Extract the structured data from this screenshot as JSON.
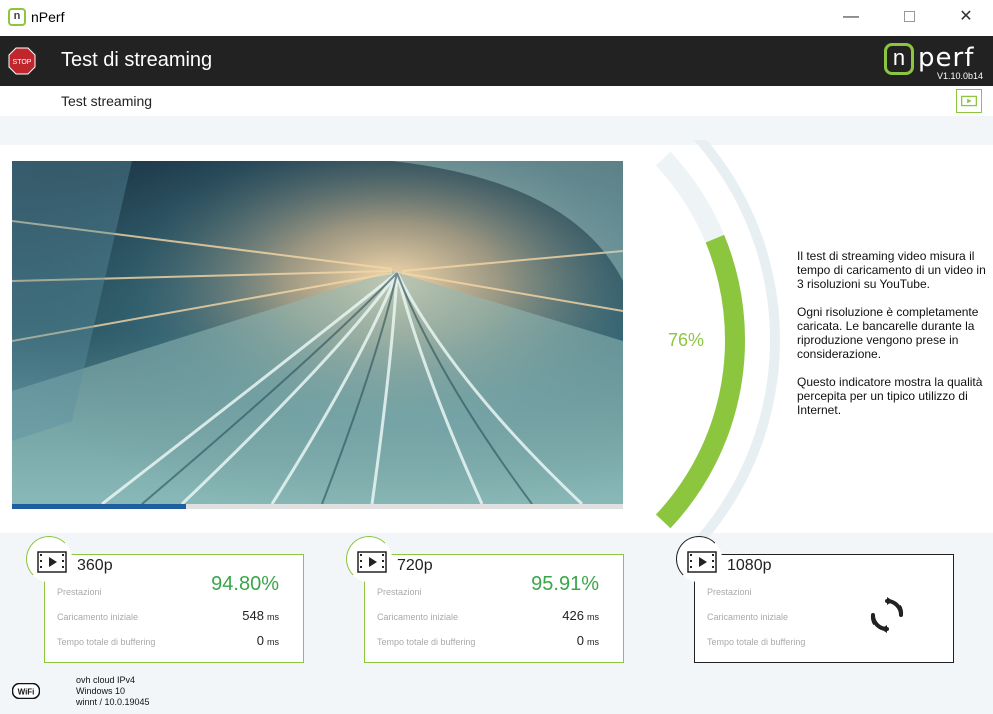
{
  "window": {
    "title": "nPerf",
    "icon_letter": "n",
    "minimize_glyph": "—",
    "close_glyph": "✕"
  },
  "header": {
    "title": "Test di streaming",
    "stop_label": "STOP",
    "logo_n": "n",
    "logo_text": "perf",
    "version": "V1.10.0b14"
  },
  "subheader": {
    "title": "Test streaming"
  },
  "video": {
    "progress_fraction": 0.285
  },
  "gauge": {
    "percent_label": "76%",
    "value": 0.76
  },
  "description": [
    "Il test di streaming video misura il tempo di caricamento di un video in 3 risoluzioni su YouTube.",
    "Ogni risoluzione è completamente caricata. Le bancarelle durante la riproduzione vengono prese in considerazione.",
    "Questo indicatore mostra la qualità percepita per un tipico utilizzo di Internet."
  ],
  "labels": {
    "performance": "Prestazioni",
    "initial_load": "Caricamento iniziale",
    "buffering": "Tempo totale di buffering",
    "unit": "ms"
  },
  "results": [
    {
      "resolution": "360p",
      "performance": "94.80%",
      "initial_load": "548",
      "buffering": "0"
    },
    {
      "resolution": "720p",
      "performance": "95.91%",
      "initial_load": "426",
      "buffering": "0"
    },
    {
      "resolution": "1080p"
    }
  ],
  "footer": {
    "wifi_label": "WiFi",
    "line1": "ovh cloud IPv4",
    "line2": "Windows 10",
    "line3": "winnt / 10.0.19045"
  },
  "colors": {
    "accent": "#8cc63f",
    "performance_text": "#3aa64a",
    "header_bg": "#222222",
    "progress": "#1f5fa0"
  }
}
